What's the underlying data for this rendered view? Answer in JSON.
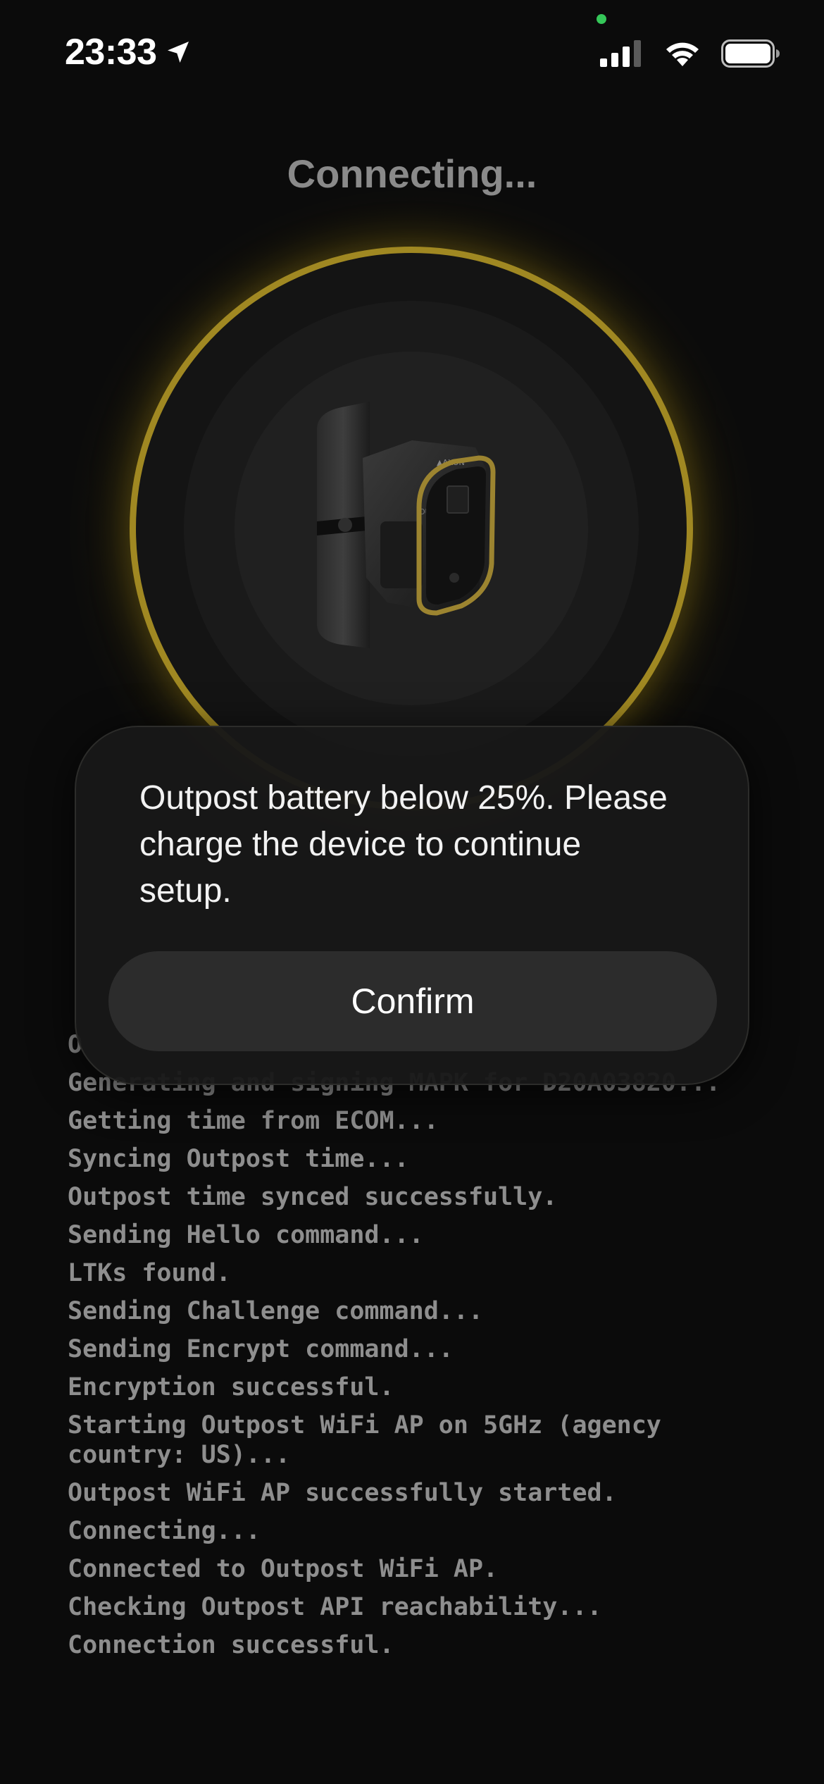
{
  "status_bar": {
    "time": "23:33",
    "icons": [
      "location-arrow-icon",
      "cellular-signal-icon",
      "wifi-icon",
      "battery-icon"
    ],
    "privacy_indicator_color": "#35c759"
  },
  "screen": {
    "title": "Connecting..."
  },
  "device_image": {
    "icon": "outpost-camera-device",
    "ring_color": "#a08822"
  },
  "modal": {
    "message": "Outpost battery below 25%. Please charge the device to continue setup.",
    "confirm_label": "Confirm"
  },
  "log": {
    "lines": [
      "O",
      "Generating and signing MAPK for D20A03820...",
      "Getting time from ECOM...",
      "Syncing Outpost time...",
      "Outpost time synced successfully.",
      "Sending Hello command...",
      "LTKs found.",
      "Sending Challenge command...",
      "Sending Encrypt command...",
      "Encryption successful.",
      "Starting Outpost WiFi AP on 5GHz (agency country: US)...",
      "Outpost WiFi AP successfully started.",
      "Connecting...",
      "Connected to Outpost WiFi AP.",
      "Checking Outpost API reachability...",
      "Connection successful."
    ]
  }
}
